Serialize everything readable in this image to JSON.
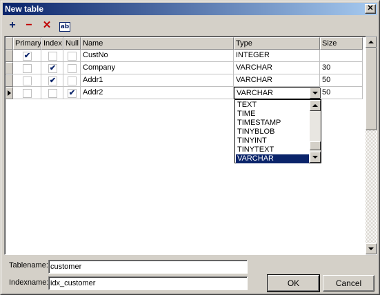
{
  "window": {
    "title": "New table",
    "close_glyph": "✕"
  },
  "toolbar": {
    "add_glyph": "+",
    "remove_glyph": "−",
    "delete_glyph": "✕",
    "rename_glyph": "ab"
  },
  "grid": {
    "columns": [
      "Primary",
      "Index",
      "Null",
      "Name",
      "Type",
      "Size"
    ],
    "rows": [
      {
        "primary": true,
        "index": false,
        "null": false,
        "name": "CustNo",
        "type": "INTEGER",
        "size": ""
      },
      {
        "primary": false,
        "index": true,
        "null": false,
        "name": "Company",
        "type": "VARCHAR",
        "size": "30"
      },
      {
        "primary": false,
        "index": true,
        "null": false,
        "name": "Addr1",
        "type": "VARCHAR",
        "size": "50"
      },
      {
        "primary": false,
        "index": false,
        "null": true,
        "name": "Addr2",
        "type": "VARCHAR",
        "size": "50"
      }
    ],
    "current_row": 3,
    "check_glyph": "✔"
  },
  "type_dropdown": {
    "options": [
      "TEXT",
      "TIME",
      "TIMESTAMP",
      "TINYBLOB",
      "TINYINT",
      "TINYTEXT",
      "VARCHAR"
    ],
    "selected": "VARCHAR"
  },
  "form": {
    "tablename_label": "Tablename:",
    "tablename_value": "customer",
    "indexname_label": "Indexname:",
    "indexname_value": "idx_customer"
  },
  "buttons": {
    "ok": "OK",
    "cancel": "Cancel"
  },
  "colors": {
    "selection": "#0a246a",
    "face": "#d4d0c8"
  }
}
